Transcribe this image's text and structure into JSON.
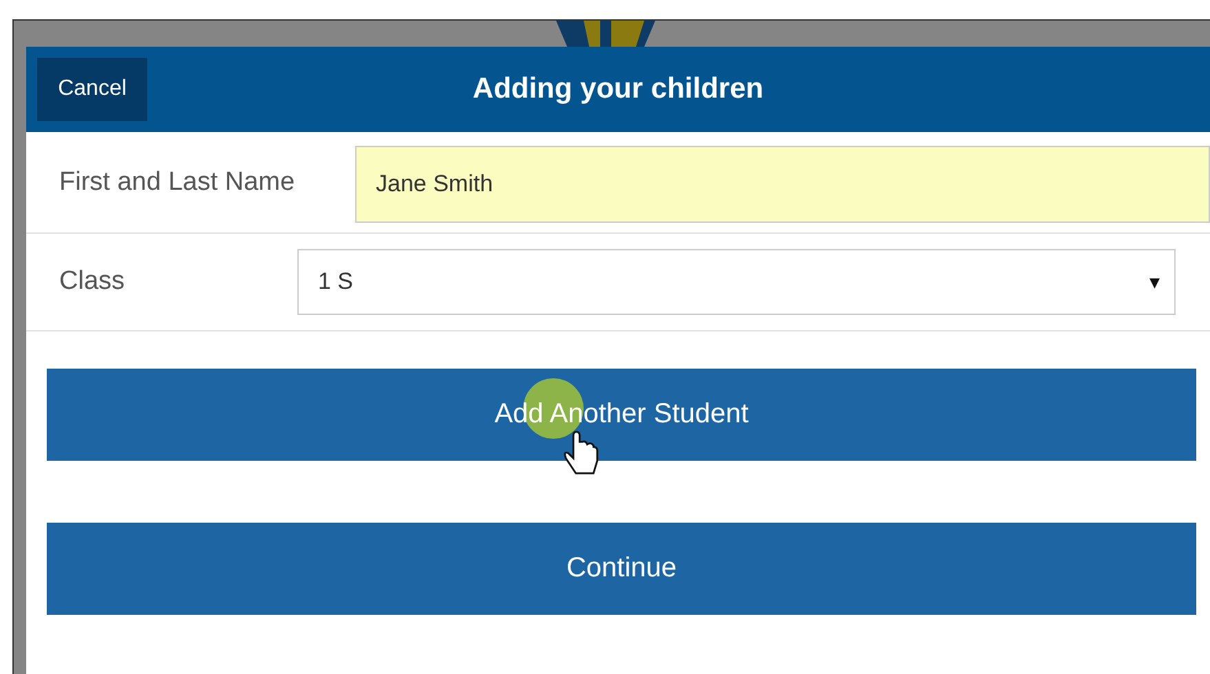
{
  "header": {
    "cancel": "Cancel",
    "title": "Adding your children"
  },
  "fields": [
    {
      "kind": "text",
      "label": "First and Last Name",
      "value": "Jane Smith",
      "highlighted": true
    },
    {
      "kind": "select",
      "label": "Class",
      "value": "1 S",
      "arrow": "▾"
    }
  ],
  "buttons": [
    {
      "label": "Add Another Student",
      "hovered": true
    },
    {
      "label": "Continue",
      "hovered": false
    }
  ]
}
